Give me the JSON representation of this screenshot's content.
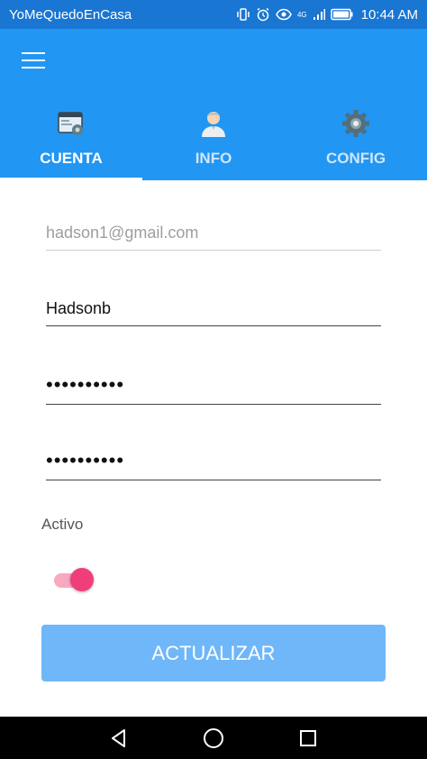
{
  "status_bar": {
    "app_name": "YoMeQuedoEnCasa",
    "time": "10:44 AM",
    "network_label": "4G"
  },
  "tabs": [
    {
      "label": "CUENTA",
      "icon": "window-settings-icon",
      "active": true
    },
    {
      "label": "INFO",
      "icon": "user-icon",
      "active": false
    },
    {
      "label": "CONFIG",
      "icon": "gear-icon",
      "active": false
    }
  ],
  "form": {
    "email": {
      "value": "hadson1@gmail.com"
    },
    "username": {
      "value": "Hadsonb"
    },
    "password": {
      "value": "••••••••••"
    },
    "password_confirm": {
      "value": "••••••••••"
    },
    "active_label": "Activo",
    "active": true,
    "submit_label": "ACTUALIZAR"
  },
  "colors": {
    "appbar": "#2196f3",
    "statusbar": "#1976d2",
    "switch_thumb": "#f03e7a",
    "button": "#6fb7f9"
  }
}
